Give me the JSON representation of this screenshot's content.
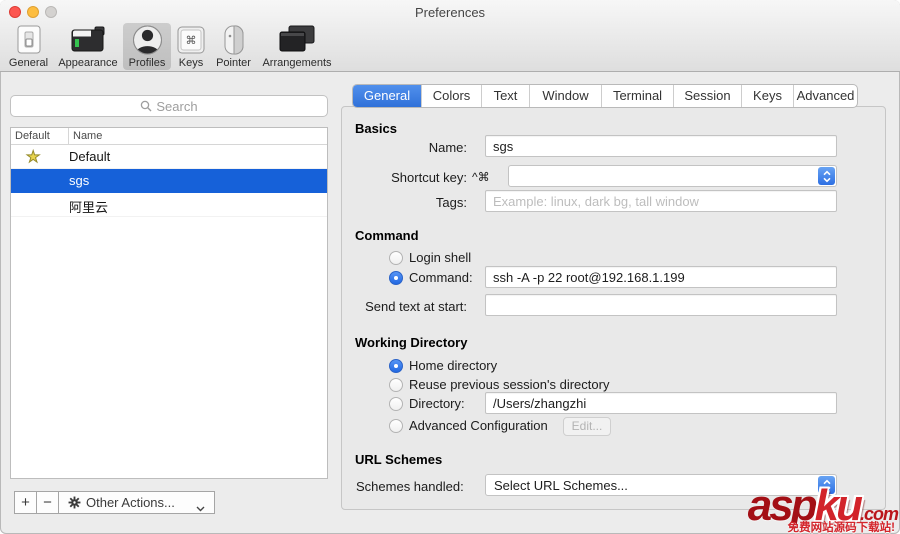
{
  "window": {
    "title": "Preferences"
  },
  "toolbar": {
    "items": [
      {
        "label": "General"
      },
      {
        "label": "Appearance"
      },
      {
        "label": "Profiles",
        "selected": true
      },
      {
        "label": "Keys"
      },
      {
        "label": "Pointer"
      },
      {
        "label": "Arrangements"
      }
    ]
  },
  "sidebar": {
    "search_placeholder": "Search",
    "columns": {
      "default": "Default",
      "name": "Name"
    },
    "star_glyph": "★",
    "profiles": [
      {
        "name": "Default",
        "is_default": true,
        "selected": false
      },
      {
        "name": "sgs",
        "is_default": false,
        "selected": true
      },
      {
        "name": "阿里云",
        "is_default": false,
        "selected": false
      }
    ],
    "add_button": "+",
    "remove_button": "−",
    "other_actions_label": "Other Actions..."
  },
  "tabs": {
    "items": [
      {
        "label": "General",
        "selected": true
      },
      {
        "label": "Colors"
      },
      {
        "label": "Text"
      },
      {
        "label": "Window"
      },
      {
        "label": "Terminal"
      },
      {
        "label": "Session"
      },
      {
        "label": "Keys"
      },
      {
        "label": "Advanced"
      }
    ]
  },
  "general_tab": {
    "basics": {
      "heading": "Basics",
      "name_label": "Name:",
      "name_value": "sgs",
      "shortcut_label": "Shortcut key:",
      "shortcut_modifiers": "^⌘",
      "shortcut_value": "",
      "tags_label": "Tags:",
      "tags_placeholder": "Example: linux, dark bg, tall window",
      "tags_value": ""
    },
    "command": {
      "heading": "Command",
      "login_shell_label": "Login shell",
      "command_radio_label": "Command:",
      "command_value": "ssh -A -p 22 root@192.168.1.199",
      "send_text_label": "Send text at start:",
      "send_text_value": ""
    },
    "working_directory": {
      "heading": "Working Directory",
      "home_label": "Home directory",
      "reuse_label": "Reuse previous session's directory",
      "directory_label": "Directory:",
      "directory_value": "/Users/zhangzhi",
      "advanced_label": "Advanced Configuration",
      "edit_button": "Edit...",
      "selected_option": "Home directory"
    },
    "url_schemes": {
      "heading": "URL Schemes",
      "schemes_label": "Schemes handled:",
      "schemes_value": "Select URL Schemes..."
    }
  },
  "watermark": {
    "brand_left": "asp",
    "brand_right": "ku",
    "brand_tld": ".com",
    "tagline": "免费网站源码下载站!"
  },
  "colors": {
    "accent_blue": "#3b7edf",
    "selection_blue": "#1661d9",
    "watermark_red": "#c0181c"
  }
}
